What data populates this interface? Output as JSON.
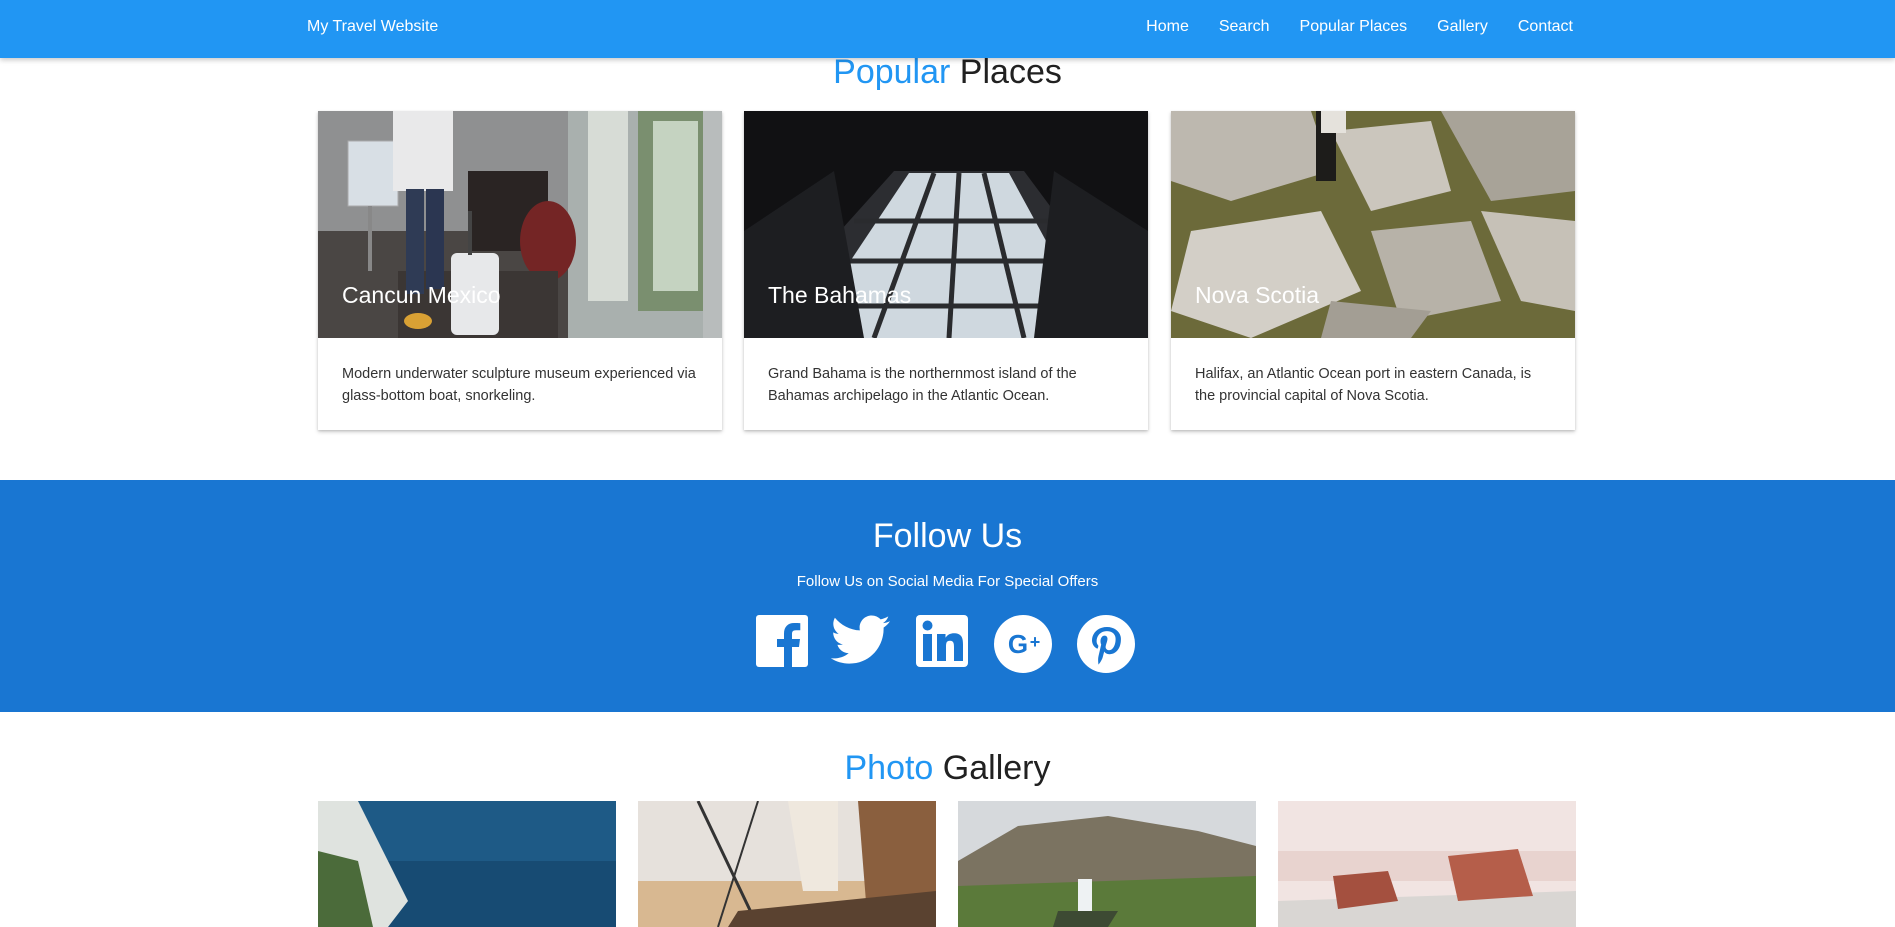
{
  "nav": {
    "brand": "My Travel Website",
    "links": [
      "Home",
      "Search",
      "Popular Places",
      "Gallery",
      "Contact"
    ]
  },
  "places": {
    "title_accent": "Popular",
    "title_rest": "Places",
    "cards": [
      {
        "title": "Cancun Mexico",
        "description": "Modern underwater sculpture museum experienced via glass-bottom boat, snorkeling."
      },
      {
        "title": "The Bahamas",
        "description": "Grand Bahama is the northernmost island of the Bahamas archipelago in the Atlantic Ocean."
      },
      {
        "title": "Nova Scotia",
        "description": "Halifax, an Atlantic Ocean port in eastern Canada, is the provincial capital of Nova Scotia."
      }
    ]
  },
  "follow": {
    "title": "Follow Us",
    "subtitle": "Follow Us on Social Media For Special Offers",
    "icons": [
      "facebook-icon",
      "twitter-icon",
      "linkedin-icon",
      "google-plus-icon",
      "pinterest-icon"
    ]
  },
  "gallery": {
    "title_accent": "Photo",
    "title_rest": "Gallery"
  },
  "colors": {
    "primary": "#2196f3",
    "follow_bg": "#1976d2",
    "text": "#212121"
  }
}
